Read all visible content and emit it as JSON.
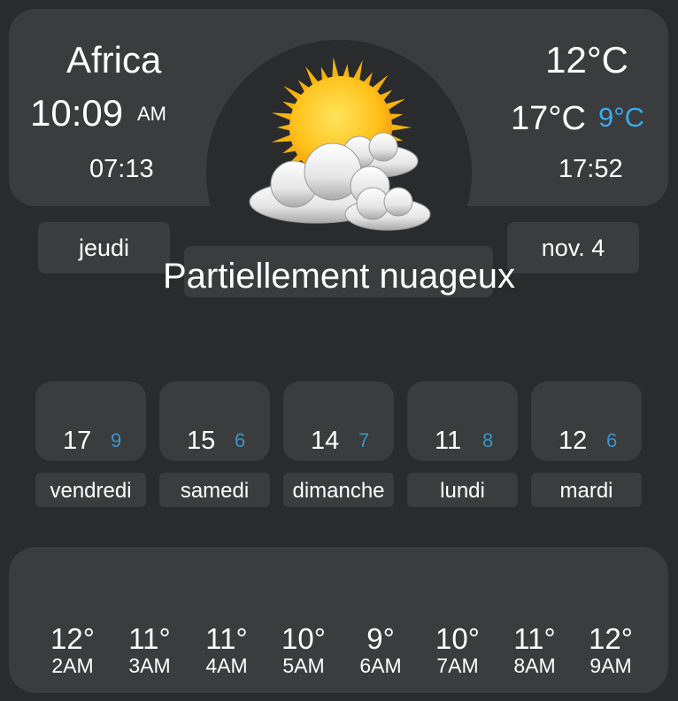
{
  "location": {
    "city": "Africa",
    "time": "10:09",
    "ampm": "AM",
    "sunrise": "07:13",
    "sunset": "17:52"
  },
  "current": {
    "temp": "12°C",
    "high": "17°C",
    "low": "9°C",
    "condition": "Partiellement nuageux",
    "icon": "sun-behind-clouds-icon"
  },
  "date": {
    "weekday": "jeudi",
    "day": "nov. 4"
  },
  "forecast": [
    {
      "day": "vendredi",
      "high": "17",
      "low": "9"
    },
    {
      "day": "samedi",
      "high": "15",
      "low": "6"
    },
    {
      "day": "dimanche",
      "high": "14",
      "low": "7"
    },
    {
      "day": "lundi",
      "high": "11",
      "low": "8"
    },
    {
      "day": "mardi",
      "high": "12",
      "low": "6"
    }
  ],
  "hourly": [
    {
      "temp": "12°",
      "time": "2AM"
    },
    {
      "temp": "11°",
      "time": "3AM"
    },
    {
      "temp": "11°",
      "time": "4AM"
    },
    {
      "temp": "10°",
      "time": "5AM"
    },
    {
      "temp": "9°",
      "time": "6AM"
    },
    {
      "temp": "10°",
      "time": "7AM"
    },
    {
      "temp": "11°",
      "time": "8AM"
    },
    {
      "temp": "12°",
      "time": "9AM"
    }
  ],
  "colors": {
    "background": "#2a2b2d",
    "panel": "#3b3c3e",
    "low_temp": "#3aa9ea"
  }
}
